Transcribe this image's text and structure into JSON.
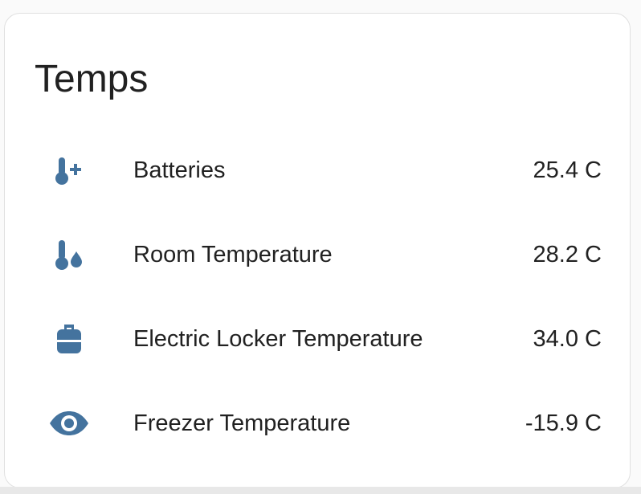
{
  "card": {
    "title": "Temps"
  },
  "colors": {
    "icon": "#44739e",
    "text": "#212121",
    "card_bg": "#ffffff",
    "page_bg": "#fafafa"
  },
  "entities": [
    {
      "name": "Batteries",
      "state": "25.4 C",
      "icon": "thermometer-plus-icon"
    },
    {
      "name": "Room Temperature",
      "state": "28.2 C",
      "icon": "thermometer-water-icon"
    },
    {
      "name": "Electric Locker Temperature",
      "state": "34.0 C",
      "icon": "gas-cylinder-icon"
    },
    {
      "name": "Freezer Temperature",
      "state": "-15.9 C",
      "icon": "eye-icon"
    }
  ]
}
